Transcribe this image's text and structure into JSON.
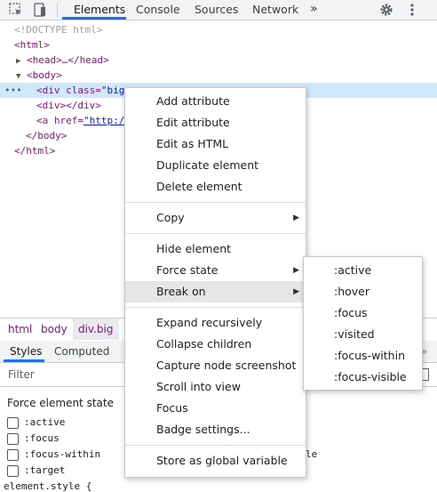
{
  "toolbar": {
    "inspect_icon": "inspect-element-icon",
    "device_icon": "device-toolbar-icon",
    "tabs": [
      "Elements",
      "Console",
      "Sources",
      "Network"
    ],
    "more_tabs": "»",
    "settings_icon": "gear-icon",
    "menu_icon": "kebab-menu-icon",
    "accent": "#1a73e8"
  },
  "tree": {
    "doctype": "<!DOCTYPE html>",
    "html_open": "<html>",
    "head_line": "<head>…</head>",
    "body_open": "<body>",
    "selected_prefix": "<div class=",
    "selected_value_visible": "\"big",
    "row_dots": "•••",
    "div_line": "<div></div>",
    "a_prefix": "<a href=",
    "a_value_visible": "\"http:/",
    "body_close": "</body>",
    "html_close": "</html>",
    "selection_color": "#cfe8fc"
  },
  "breadcrumb": [
    "html",
    "body",
    "div.big"
  ],
  "styles_panel": {
    "tabs": [
      "Styles",
      "Computed"
    ],
    "filter_placeholder": "Filter",
    "force_state_title": "Force element state",
    "states": [
      ":active",
      ":focus",
      ":focus-within",
      ":target"
    ],
    "partial_text_right": "le",
    "bottom_text": "element.style {"
  },
  "context_menu": {
    "groups": [
      [
        "Add attribute",
        "Edit attribute",
        "Edit as HTML",
        "Duplicate element",
        "Delete element"
      ],
      [
        "Copy"
      ],
      [
        "Hide element",
        "Force state",
        "Break on"
      ],
      [
        "Expand recursively",
        "Collapse children",
        "Capture node screenshot",
        "Scroll into view",
        "Focus",
        "Badge settings..."
      ],
      [
        "Store as global variable"
      ]
    ],
    "highlighted": "Break on",
    "has_submenu": [
      "Copy",
      "Force state",
      "Break on"
    ]
  },
  "force_state_submenu": [
    ":active",
    ":hover",
    ":focus",
    ":visited",
    ":focus-within",
    ":focus-visible"
  ]
}
